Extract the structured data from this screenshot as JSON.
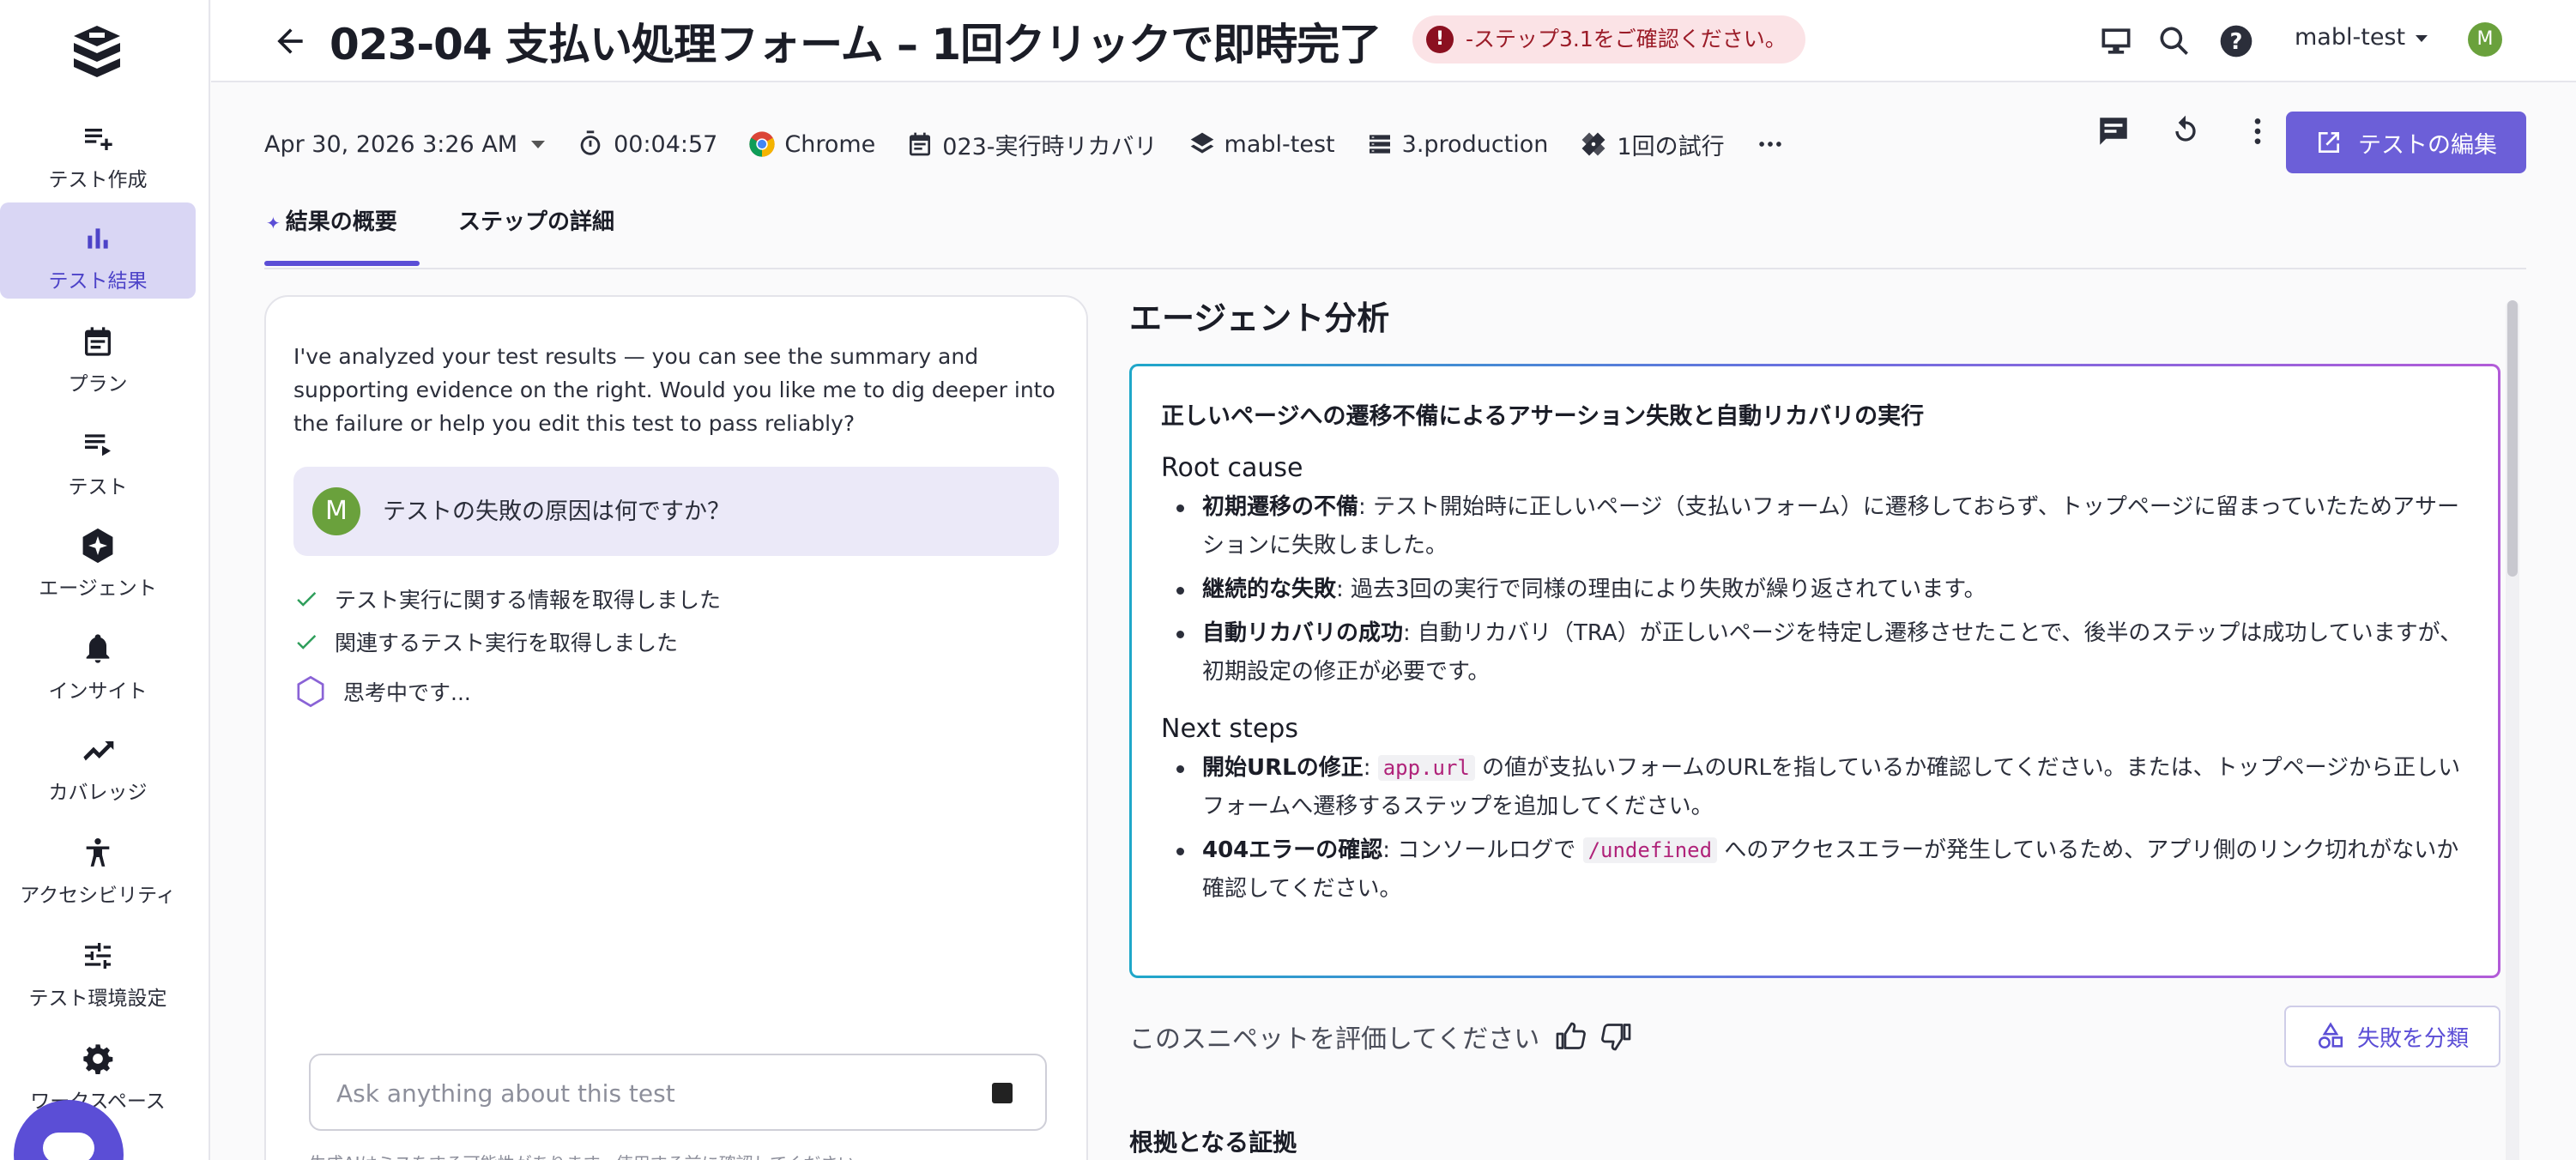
{
  "sidebar": {
    "items": [
      {
        "label": "テスト作成",
        "icon": "playlist-add-icon"
      },
      {
        "label": "テスト結果",
        "icon": "bar-chart-icon"
      },
      {
        "label": "プラン",
        "icon": "calendar-icon"
      },
      {
        "label": "テスト",
        "icon": "list-icon"
      },
      {
        "label": "エージェント",
        "icon": "agent-icon"
      },
      {
        "label": "インサイト",
        "icon": "bell-icon"
      },
      {
        "label": "カバレッジ",
        "icon": "trending-up-icon"
      },
      {
        "label": "アクセシビリティ",
        "icon": "accessibility-icon"
      },
      {
        "label": "テスト環境設定",
        "icon": "sliders-icon"
      },
      {
        "label": "ワークスペース",
        "icon": "gear-icon"
      }
    ],
    "active_index": 1
  },
  "header": {
    "title": "023-04 支払い処理フォーム – 1回クリックで即時完了",
    "warning": "-ステップ3.1をご確認ください。",
    "workspace": "mabl-test",
    "avatar_initial": "M"
  },
  "meta": {
    "datetime": "Apr 30, 2026 3:26 AM",
    "duration": "00:04:57",
    "browser": "Chrome",
    "plan": "023-実行時リカバリ",
    "workspace": "mabl-test",
    "environment": "3.production",
    "attempts": "1回の試行"
  },
  "actions": {
    "edit_label": "テストの編集"
  },
  "tabs": [
    {
      "label": "結果の概要"
    },
    {
      "label": "ステップの詳細"
    }
  ],
  "chat": {
    "intro": "I've analyzed your test results — you can see the summary and supporting evidence on the right. Would you like me to dig deeper into the failure or help you edit this test to pass reliably?",
    "user_initial": "M",
    "user_message": "テストの失敗の原因は何ですか？",
    "steps": [
      {
        "label": "テスト実行に関する情報を取得しました",
        "state": "done"
      },
      {
        "label": "関連するテスト実行を取得しました",
        "state": "done"
      },
      {
        "label": "思考中です...",
        "state": "pending"
      }
    ],
    "input_placeholder": "Ask anything about this test",
    "disclaimer": "生成AIはミスをする可能性があります。使用する前に確認してください。"
  },
  "analysis": {
    "title": "エージェント分析",
    "headline": "正しいページへの遷移不備によるアサーション失敗と自動リカバリの実行",
    "root_cause_heading": "Root cause",
    "root_cause": [
      {
        "term": "初期遷移の不備",
        "text": ": テスト開始時に正しいページ（支払いフォーム）に遷移しておらず、トップページに留まっていたためアサーションに失敗しました。"
      },
      {
        "term": "継続的な失敗",
        "text": ": 過去3回の実行で同様の理由により失敗が繰り返されています。"
      },
      {
        "term": "自動リカバリの成功",
        "text": ": 自動リカバリ（TRA）が正しいページを特定し遷移させたことで、後半のステップは成功していますが、初期設定の修正が必要です。"
      }
    ],
    "next_steps_heading": "Next steps",
    "next_steps": [
      {
        "term": "開始URLの修正",
        "pre": ": ",
        "code": "app.url",
        "text": " の値が支払いフォームのURLを指しているか確認してください。または、トップページから正しいフォームへ遷移するステップを追加してください。"
      },
      {
        "term": "404エラーの確認",
        "pre": ": コンソールログで ",
        "code": "/undefined",
        "text": " へのアクセスエラーが発生しているため、アプリ側のリンク切れがないか確認してください。"
      }
    ],
    "rate_label": "このスニペットを評価してください",
    "classify_label": "失敗を分類",
    "evidence_heading": "根拠となる証拠"
  },
  "colors": {
    "accent": "#5b4ed6",
    "active_nav_bg": "#d9d6f4",
    "warning_bg": "#fbe3e6",
    "warning_text": "#9b1c28",
    "success": "#2e9e5b",
    "code_text": "#b0237a"
  }
}
